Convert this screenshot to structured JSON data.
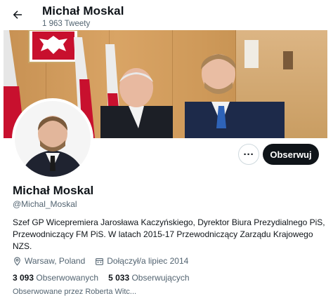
{
  "header": {
    "name": "Michał Moskal",
    "tweet_count": "1 963 Tweety"
  },
  "profile": {
    "name": "Michał Moskal",
    "handle": "@Michal_Moskal",
    "bio": "Szef GP Wicepremiera Jarosława Kaczyńskiego, Dyrektor Biura Prezydialnego PiS, Przewodniczący FM PiS. W latach 2015-17 Przewodniczący Zarządu Krajowego NZS.",
    "location": "Warsaw, Poland",
    "joined": "Dołączył/a lipiec 2014",
    "following_count": "3 093",
    "following_label": "Obserwowanych",
    "followers_count": "5 033",
    "followers_label": "Obserwujących",
    "followed_by": "Obserwowane przez Roberta Witc..."
  },
  "actions": {
    "more": "···",
    "follow": "Obserwuj"
  },
  "colors": {
    "text": "#0f1419",
    "secondary": "#536471",
    "follow_bg": "#0f1419"
  }
}
